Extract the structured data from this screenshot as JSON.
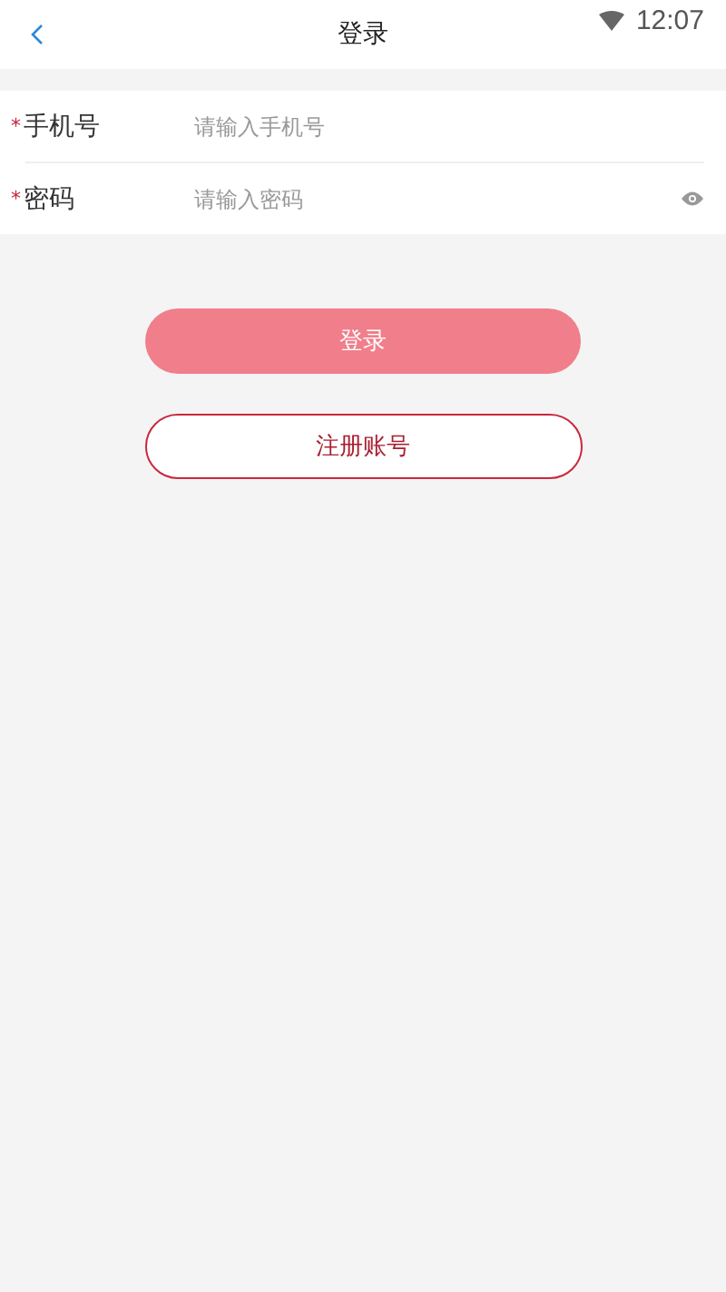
{
  "status_bar": {
    "time": "12:07"
  },
  "header": {
    "title": "登录"
  },
  "fields": [
    {
      "required_mark": "*",
      "label": "手机号",
      "placeholder": "请输入手机号",
      "kind": "text"
    },
    {
      "required_mark": "*",
      "label": "密码",
      "placeholder": "请输入密码",
      "kind": "password"
    }
  ],
  "login_button": {
    "label": "登录",
    "disabled": true
  },
  "register_button": {
    "label": "注册账号"
  }
}
